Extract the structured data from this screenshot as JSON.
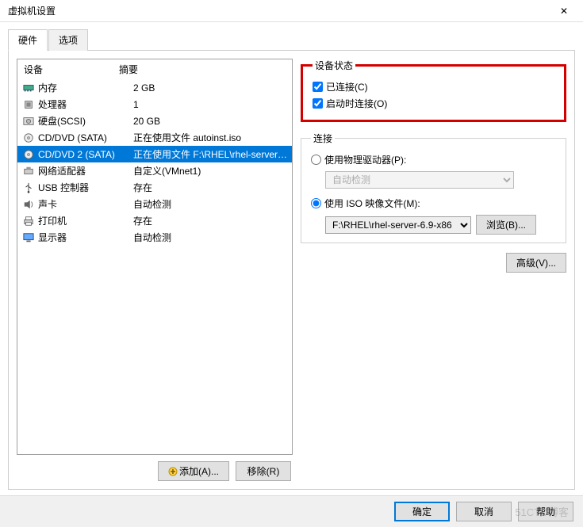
{
  "window": {
    "title": "虚拟机设置"
  },
  "tabs": {
    "hardware": "硬件",
    "options": "选项"
  },
  "columns": {
    "device": "设备",
    "summary": "摘要"
  },
  "devices": [
    {
      "name": "内存",
      "summary": "2 GB"
    },
    {
      "name": "处理器",
      "summary": "1"
    },
    {
      "name": "硬盘(SCSI)",
      "summary": "20 GB"
    },
    {
      "name": "CD/DVD (SATA)",
      "summary": "正在使用文件 autoinst.iso"
    },
    {
      "name": "CD/DVD 2 (SATA)",
      "summary": "正在使用文件 F:\\RHEL\\rhel-server-6..."
    },
    {
      "name": "网络适配器",
      "summary": "自定义(VMnet1)"
    },
    {
      "name": "USB 控制器",
      "summary": "存在"
    },
    {
      "name": "声卡",
      "summary": "自动检测"
    },
    {
      "name": "打印机",
      "summary": "存在"
    },
    {
      "name": "显示器",
      "summary": "自动检测"
    }
  ],
  "deviceStatus": {
    "legend": "设备状态",
    "connected": "已连接(C)",
    "connectAtPowerOn": "启动时连接(O)"
  },
  "connection": {
    "legend": "连接",
    "usePhysical": "使用物理驱动器(P):",
    "autoDetect": "自动检测",
    "useIso": "使用 ISO 映像文件(M):",
    "isoPath": "F:\\RHEL\\rhel-server-6.9-x86",
    "browse": "浏览(B)...",
    "advanced": "高级(V)..."
  },
  "buttons": {
    "add": "添加(A)...",
    "remove": "移除(R)",
    "ok": "确定",
    "cancel": "取消",
    "help": "帮助"
  },
  "watermark": "51CTO博客"
}
